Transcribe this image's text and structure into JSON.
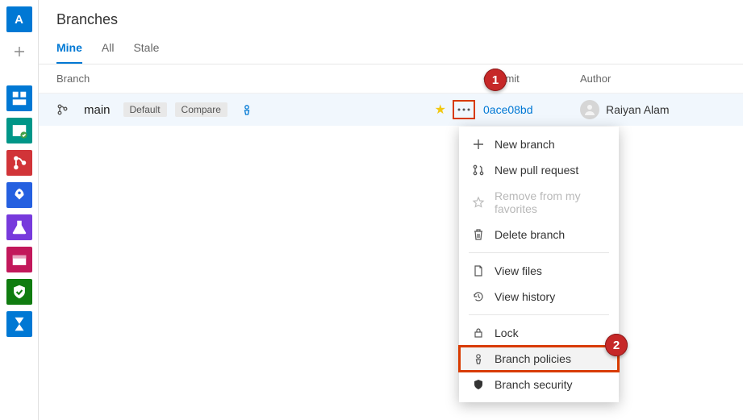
{
  "rail": {
    "avatar_letter": "A"
  },
  "page": {
    "title": "Branches"
  },
  "tabs": {
    "mine": "Mine",
    "all": "All",
    "stale": "Stale"
  },
  "columns": {
    "branch": "Branch",
    "commit": "Commit",
    "author": "Author"
  },
  "row": {
    "branch_name": "main",
    "default_badge": "Default",
    "compare_badge": "Compare",
    "commit": "0ace08bd",
    "author": "Raiyan Alam"
  },
  "menu": {
    "new_branch": "New branch",
    "new_pr": "New pull request",
    "remove_fav": "Remove from my favorites",
    "delete_branch": "Delete branch",
    "view_files": "View files",
    "view_history": "View history",
    "lock": "Lock",
    "branch_policies": "Branch policies",
    "branch_security": "Branch security"
  },
  "callouts": {
    "one": "1",
    "two": "2"
  }
}
